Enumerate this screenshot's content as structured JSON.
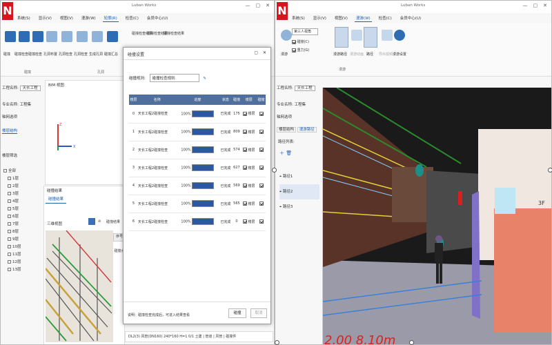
{
  "left_app": {
    "title": "Luban Works",
    "logo": "N",
    "menu": [
      "系统(S)",
      "显示(V)",
      "视图(V)",
      "漫游(W)",
      "轮廓(R)",
      "检查(C)",
      "会员中心(U)"
    ],
    "active_menu": "轮廓(R)",
    "ribbon_groups": [
      "碰撞",
      "孔洞"
    ],
    "ribbon_buttons": [
      "碰撞",
      "碰撞检查",
      "碰撞检查",
      "孔洞布置",
      "孔洞检查",
      "孔洞检查",
      "生成孔洞",
      "碰撞汇总"
    ],
    "ribbon_small": [
      "碰撞检查结果",
      "碰撞检查结果",
      "碰撞检查结果"
    ],
    "project_label": "工程名称:",
    "project_name": "天长工程",
    "project_btn": "漫步",
    "bim_tab": "BIM 视图",
    "profession_label": "专业名称:",
    "profession": "工程集",
    "group_label": "轴网选项",
    "floor_tab": "楼层结构",
    "filter_label": "楼层筛选",
    "tree": [
      "全部",
      "1层",
      "2层",
      "3层",
      "4层",
      "5层",
      "6层",
      "7层",
      "8层",
      "9层",
      "10层",
      "11层",
      "12层",
      "13层"
    ],
    "collision_panel": "碰撞结果",
    "collision_tab": "碰撞结果",
    "view_label": "三维视图",
    "result_label": "碰撞结果",
    "cell_col": "序号",
    "cell_val": "碰撞点",
    "footer_text": "DL2(3)  风管(DN160)  240*160  H=1  0/1  土建 | 管道 | 风管 | 碰撞件"
  },
  "dialog": {
    "title": "碰撞设置",
    "close": "✕",
    "max": "▢",
    "scheme_label": "碰撞规则:",
    "scheme_value": "碰撞检查规则",
    "headers": [
      "楼层",
      "名称",
      "进度",
      "状态",
      "碰撞",
      "楼层",
      "碰撞"
    ],
    "rows": [
      {
        "idx": "0",
        "name": "天长工程2碰撞检查",
        "pct": "100%",
        "status": "已完成",
        "count": "175",
        "mode": "楼层"
      },
      {
        "idx": "1",
        "name": "天长工程2碰撞检查",
        "pct": "100%",
        "status": "已完成",
        "count": "809",
        "mode": "楼层"
      },
      {
        "idx": "2",
        "name": "天长工程2碰撞检查",
        "pct": "100%",
        "status": "已完成",
        "count": "574",
        "mode": "楼层"
      },
      {
        "idx": "3",
        "name": "天长工程2碰撞检查",
        "pct": "100%",
        "status": "已完成",
        "count": "627",
        "mode": "楼层"
      },
      {
        "idx": "4",
        "name": "天长工程2碰撞检查",
        "pct": "100%",
        "status": "已完成",
        "count": "569",
        "mode": "楼层"
      },
      {
        "idx": "5",
        "name": "天长工程2碰撞检查",
        "pct": "100%",
        "status": "已完成",
        "count": "565",
        "mode": "楼层"
      },
      {
        "idx": "6",
        "name": "天长工程2碰撞检查",
        "pct": "100%",
        "status": "已完成",
        "count": "0",
        "mode": "楼层"
      }
    ],
    "footer_note": "说明：碰撞检查完成后，可进入结果查看",
    "ok": "碰撞",
    "cancel": "取消"
  },
  "right_app": {
    "title": "Luban Works",
    "logo": "N",
    "menu": [
      "系统(S)",
      "显示(V)",
      "视图(V)",
      "漫游(W)",
      "检查(C)",
      "会员中心(U)"
    ],
    "active_menu": "漫游(W)",
    "ribbon_group": "漫游",
    "ribbon_select": "第三人视角",
    "opt1": "碰撞(C)",
    "opt2": "重力(G)",
    "ribbon_buttons": [
      "漫游",
      "漫游路径",
      "漫游动画",
      "路径",
      "导出视频",
      "漫游设置"
    ],
    "project_label": "工程名称:",
    "project_name": "天长工程",
    "project_btn": "漫步",
    "bim_tab": "BIM 视图",
    "profession_label": "专业名称:",
    "profession": "工程集",
    "group_label": "轴网选项",
    "tabs": [
      "楼层结构",
      "漫游路径"
    ],
    "path_label": "路径列表:",
    "paths": [
      "路径1",
      "路径2",
      "路径3"
    ],
    "floor_text": "3F",
    "overlay_text": "2.00  8.10m"
  }
}
